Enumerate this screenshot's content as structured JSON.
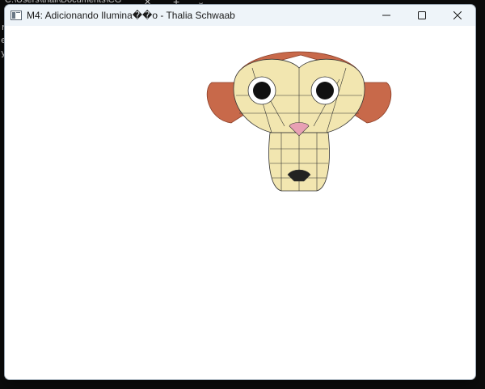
{
  "background_terminal": {
    "tab_title": "C:\\Users\\thali\\Documents\\CG",
    "tab_close_glyph": "✕",
    "new_tab_glyph": "+",
    "tab_menu_glyph": "⌄",
    "visible_line_fragments": [
      "r",
      "e",
      "y"
    ]
  },
  "window": {
    "title": "M4: Adicionando Ilumina��o - Thalia Schwaab",
    "icon": "app-window-icon",
    "controls": {
      "minimize_icon": "minimize-icon",
      "maximize_icon": "maximize-icon",
      "close_icon": "close-icon"
    }
  },
  "render": {
    "model": "wireframe monkey head",
    "colors": {
      "face": "#f2e6b0",
      "fur": "#c8694a",
      "eye_pupil": "#111111",
      "eye_white": "#ffffff",
      "nose": "#e8a0b4",
      "wire": "#333333"
    }
  }
}
